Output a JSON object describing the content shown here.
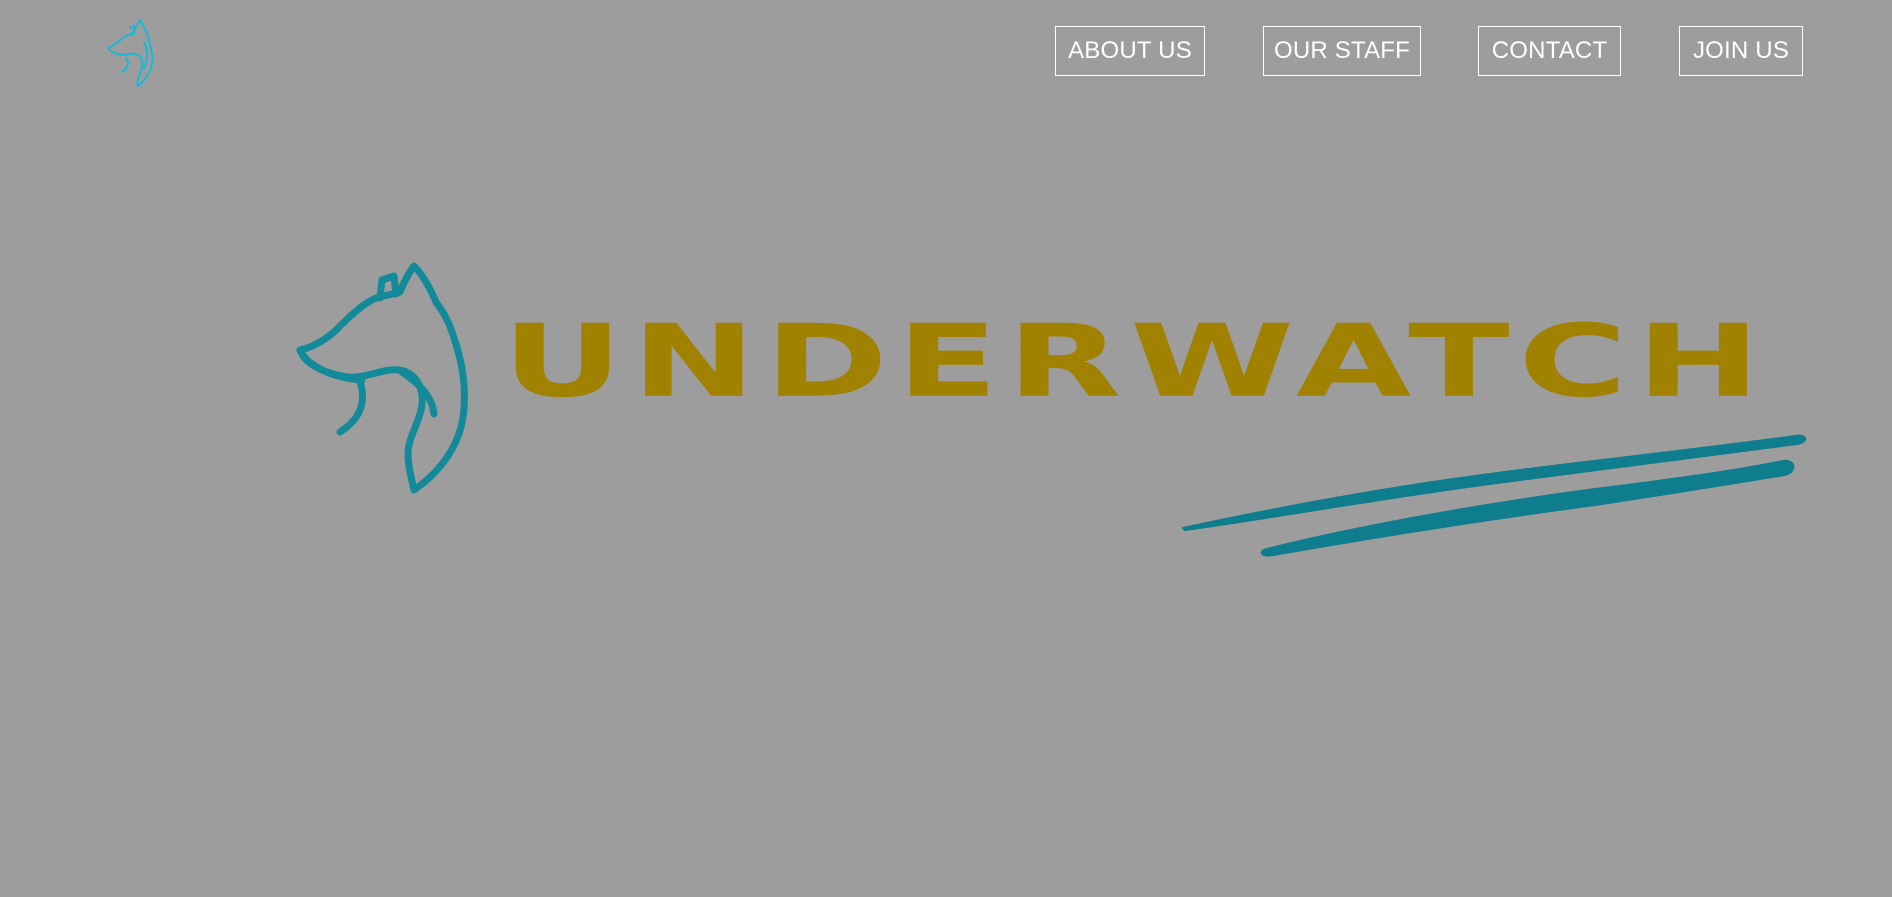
{
  "header": {
    "logo_icon": "fox-head-outline-icon",
    "nav": [
      {
        "label": "ABOUT US"
      },
      {
        "label": "OUR STAFF"
      },
      {
        "label": "CONTACT"
      },
      {
        "label": "JOIN US"
      }
    ]
  },
  "hero": {
    "brand_name": "UNDERWATCH",
    "emblem_icon": "fox-head-outline-icon",
    "decoration": "brush-stroke-underline"
  },
  "colors": {
    "background": "#9d9d9d",
    "nav_border_text": "#ffffff",
    "corner_logo": "#1ab8d6",
    "emblem_teal": "#138a9a",
    "brand_gold": "#a08200"
  }
}
